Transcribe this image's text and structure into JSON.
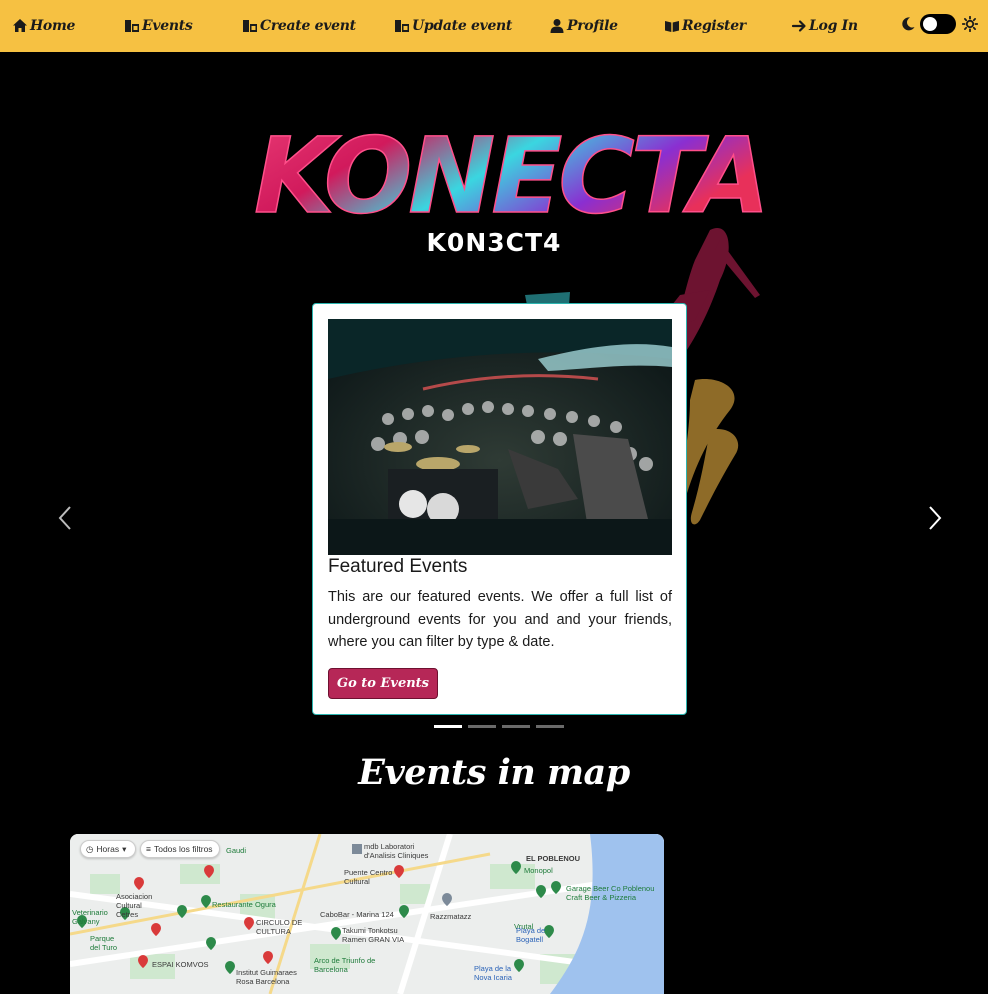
{
  "nav": {
    "home": "Home",
    "events": "Events",
    "create_event": "Create event",
    "update_event": "Update event",
    "profile": "Profile",
    "register": "Register",
    "login": "Log In"
  },
  "hero": {
    "logo_text": "KONECTA",
    "logo_subtitle": "K0N3CT4"
  },
  "carousel": {
    "card_title": "Featured Events",
    "card_text": "This are our featured events. We offer a full list of underground events for you and and your friends, where you can filter by type & date.",
    "button_label": "Go to Events",
    "slide_count": 4,
    "active_slide": 1
  },
  "map_section": {
    "heading": "Events in map",
    "chip_hours": "Horas",
    "chip_filters": "Todos los filtros",
    "labels": [
      "mdb Laboratori d'Analisis Cliniques",
      "EL POBLENOU",
      "Monopol",
      "Puente Centro Cultural",
      "Garage Beer Co Poblenou Craft Beer & Pizzeria",
      "Asociacion Cultural Cetres",
      "Restaurante Ogura",
      "CaboBar - Marina 124",
      "Razzmatazz",
      "Vrutal",
      "CIRCULO DE CULTURA",
      "Takumi Tonkotsu Ramen GRAN VIA",
      "Playa de Bogatell",
      "ESPAI KOMVOS",
      "Institut Guimaraes Rosa Barcelona",
      "Arco de Triunfo de Barcelona",
      "Playa de la Nova Icaria",
      "Parque del Turo",
      "Veterinario Galvany",
      "Gaudi"
    ]
  },
  "colors": {
    "navbar": "#f6c142",
    "accent_button": "#b62757",
    "card_border": "#2bb5b0",
    "background": "#000000"
  }
}
